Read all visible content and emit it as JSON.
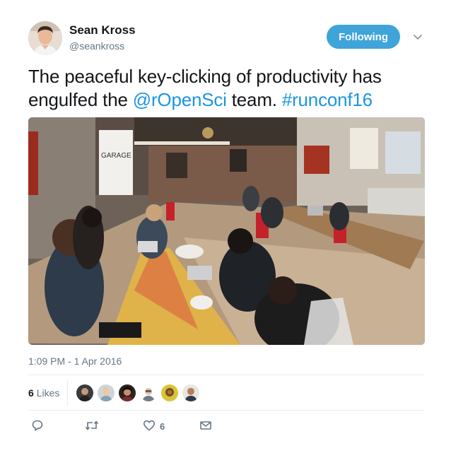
{
  "user": {
    "name": "Sean Kross",
    "handle": "@seankross"
  },
  "follow_button": {
    "label": "Following"
  },
  "tweet": {
    "text_part1": "The peaceful key-clicking of productivity has engulfed the ",
    "mention": "@rOpenSci",
    "text_part2": " team. ",
    "hashtag": "#runconf16",
    "timestamp": "1:09 PM - 1 Apr 2016"
  },
  "photo": {
    "wall_sign": "GARAGE"
  },
  "likes": {
    "count": "6",
    "label": "Likes",
    "avatars": [
      "liker-1",
      "liker-2",
      "liker-3",
      "liker-4",
      "liker-5",
      "liker-6"
    ]
  },
  "actions": {
    "reply_icon": "speech-bubble-icon",
    "retweet_icon": "retweet-icon",
    "like_icon": "heart-icon",
    "like_count": "6",
    "dm_icon": "envelope-icon"
  },
  "colors": {
    "accent": "#3ea4d9",
    "link": "#1b95e0",
    "muted": "#657786"
  }
}
